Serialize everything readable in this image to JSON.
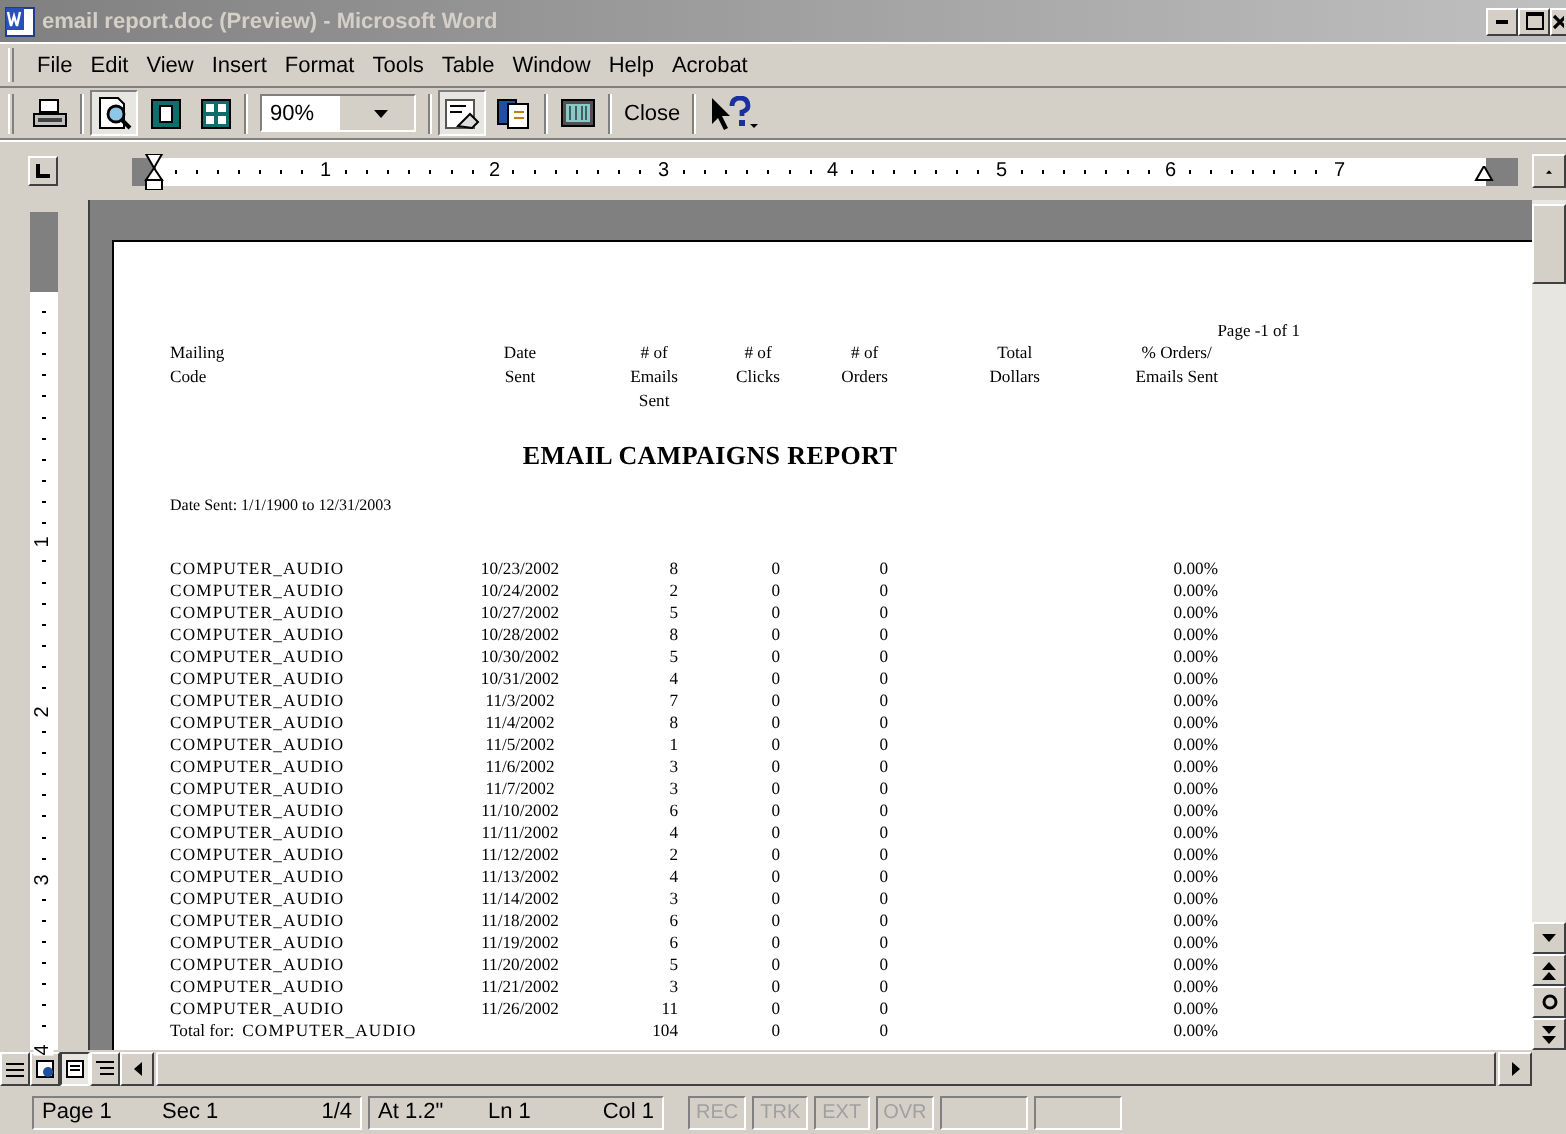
{
  "window": {
    "title": "email report.doc (Preview) - Microsoft Word"
  },
  "menu": [
    "File",
    "Edit",
    "View",
    "Insert",
    "Format",
    "Tools",
    "Table",
    "Window",
    "Help",
    "Acrobat"
  ],
  "toolbar": [
    {
      "kind": "icon",
      "pressed": false
    },
    {
      "kind": "icon",
      "pressed": true
    },
    {
      "kind": "icon",
      "pressed": false
    },
    {
      "kind": "icon",
      "pressed": false
    },
    {
      "kind": "combo",
      "value": "90%"
    },
    {
      "kind": "icon",
      "pressed": true
    },
    {
      "kind": "icon",
      "pressed": false
    },
    {
      "kind": "icon",
      "pressed": false
    },
    {
      "kind": "text",
      "label": "Close"
    },
    {
      "kind": "icon",
      "pressed": false
    }
  ],
  "ruler": {
    "marks": [
      "1",
      "2",
      "3",
      "4",
      "5",
      "6",
      "7"
    ]
  },
  "vertical_ruler": {
    "marks": [
      "1",
      "2",
      "3",
      "4"
    ]
  },
  "document": {
    "page_label": "Page -1 of 1",
    "columns": [
      "Mailing\nCode",
      "Date\nSent",
      "# of\nEmails\nSent",
      "# of\nClicks",
      "# of\nOrders",
      "Total\nDollars",
      "% Orders/\nEmails Sent"
    ],
    "title": "EMAIL CAMPAIGNS REPORT",
    "date_range": "Date Sent: 1/1/1900 to 12/31/2003",
    "rows": [
      {
        "mailing_code": "COMPUTER_AUDIO",
        "date_sent": "10/23/2002",
        "emails_sent": "8",
        "clicks": "0",
        "orders": "0",
        "percent": "0.00%"
      },
      {
        "mailing_code": "COMPUTER_AUDIO",
        "date_sent": "10/24/2002",
        "emails_sent": "2",
        "clicks": "0",
        "orders": "0",
        "percent": "0.00%"
      },
      {
        "mailing_code": "COMPUTER_AUDIO",
        "date_sent": "10/27/2002",
        "emails_sent": "5",
        "clicks": "0",
        "orders": "0",
        "percent": "0.00%"
      },
      {
        "mailing_code": "COMPUTER_AUDIO",
        "date_sent": "10/28/2002",
        "emails_sent": "8",
        "clicks": "0",
        "orders": "0",
        "percent": "0.00%"
      },
      {
        "mailing_code": "COMPUTER_AUDIO",
        "date_sent": "10/30/2002",
        "emails_sent": "5",
        "clicks": "0",
        "orders": "0",
        "percent": "0.00%"
      },
      {
        "mailing_code": "COMPUTER_AUDIO",
        "date_sent": "10/31/2002",
        "emails_sent": "4",
        "clicks": "0",
        "orders": "0",
        "percent": "0.00%"
      },
      {
        "mailing_code": "COMPUTER_AUDIO",
        "date_sent": "11/3/2002",
        "emails_sent": "7",
        "clicks": "0",
        "orders": "0",
        "percent": "0.00%"
      },
      {
        "mailing_code": "COMPUTER_AUDIO",
        "date_sent": "11/4/2002",
        "emails_sent": "8",
        "clicks": "0",
        "orders": "0",
        "percent": "0.00%"
      },
      {
        "mailing_code": "COMPUTER_AUDIO",
        "date_sent": "11/5/2002",
        "emails_sent": "1",
        "clicks": "0",
        "orders": "0",
        "percent": "0.00%"
      },
      {
        "mailing_code": "COMPUTER_AUDIO",
        "date_sent": "11/6/2002",
        "emails_sent": "3",
        "clicks": "0",
        "orders": "0",
        "percent": "0.00%"
      },
      {
        "mailing_code": "COMPUTER_AUDIO",
        "date_sent": "11/7/2002",
        "emails_sent": "3",
        "clicks": "0",
        "orders": "0",
        "percent": "0.00%"
      },
      {
        "mailing_code": "COMPUTER_AUDIO",
        "date_sent": "11/10/2002",
        "emails_sent": "6",
        "clicks": "0",
        "orders": "0",
        "percent": "0.00%"
      },
      {
        "mailing_code": "COMPUTER_AUDIO",
        "date_sent": "11/11/2002",
        "emails_sent": "4",
        "clicks": "0",
        "orders": "0",
        "percent": "0.00%"
      },
      {
        "mailing_code": "COMPUTER_AUDIO",
        "date_sent": "11/12/2002",
        "emails_sent": "2",
        "clicks": "0",
        "orders": "0",
        "percent": "0.00%"
      },
      {
        "mailing_code": "COMPUTER_AUDIO",
        "date_sent": "11/13/2002",
        "emails_sent": "4",
        "clicks": "0",
        "orders": "0",
        "percent": "0.00%"
      },
      {
        "mailing_code": "COMPUTER_AUDIO",
        "date_sent": "11/14/2002",
        "emails_sent": "3",
        "clicks": "0",
        "orders": "0",
        "percent": "0.00%"
      },
      {
        "mailing_code": "COMPUTER_AUDIO",
        "date_sent": "11/18/2002",
        "emails_sent": "6",
        "clicks": "0",
        "orders": "0",
        "percent": "0.00%"
      },
      {
        "mailing_code": "COMPUTER_AUDIO",
        "date_sent": "11/19/2002",
        "emails_sent": "6",
        "clicks": "0",
        "orders": "0",
        "percent": "0.00%"
      },
      {
        "mailing_code": "COMPUTER_AUDIO",
        "date_sent": "11/20/2002",
        "emails_sent": "5",
        "clicks": "0",
        "orders": "0",
        "percent": "0.00%"
      },
      {
        "mailing_code": "COMPUTER_AUDIO",
        "date_sent": "11/21/2002",
        "emails_sent": "3",
        "clicks": "0",
        "orders": "0",
        "percent": "0.00%"
      },
      {
        "mailing_code": "COMPUTER_AUDIO",
        "date_sent": "11/26/2002",
        "emails_sent": "11",
        "clicks": "0",
        "orders": "0",
        "percent": "0.00%"
      }
    ],
    "total": {
      "label": "Total for:",
      "mailing_code": "COMPUTER_AUDIO",
      "emails_sent": "104",
      "clicks": "0",
      "orders": "0",
      "percent": "0.00%"
    }
  },
  "status_bar": {
    "position": [
      "Page 1",
      "Sec 1",
      "1/4"
    ],
    "cursor": [
      "At 1.2\"",
      "Ln 1",
      "Col 1"
    ],
    "indicators": [
      {
        "label": "REC",
        "disabled": true
      },
      {
        "label": "TRK",
        "disabled": true
      },
      {
        "label": "EXT",
        "disabled": true
      },
      {
        "label": "OVR",
        "disabled": true
      }
    ]
  }
}
